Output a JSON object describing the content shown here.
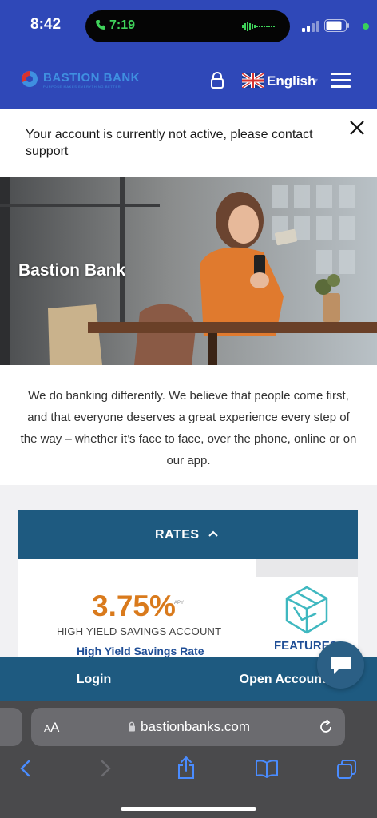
{
  "status_bar": {
    "time": "8:42",
    "call_time": "7:19",
    "colors": {
      "call": "#3fd25a",
      "background": "#2f48b8"
    }
  },
  "header": {
    "logo_text": "BASTION BANK",
    "logo_tagline": "PURPOSE MAKES EVERYTHING BETTER",
    "language": "English",
    "icons": [
      "lock-icon",
      "uk-flag-icon",
      "hamburger-menu-icon"
    ]
  },
  "alert": {
    "message": "Your account is currently not active, please contact support"
  },
  "hero": {
    "title": "Bastion Bank"
  },
  "intro": {
    "text": "We do banking differently. We believe that people come first, and that everyone deserves a great experience every step of the way – whether it’s face to face, over the phone, online or on our app."
  },
  "rates": {
    "header_label": "RATES",
    "rate_value": "3.75%",
    "rate_unit": "APY",
    "account_name": "HIGH YIELD SAVINGS ACCOUNT",
    "link_label": "High Yield Savings Rate",
    "feature_label": "FEATURES"
  },
  "actions": {
    "login": "Login",
    "open_account": "Open Account"
  },
  "browser": {
    "aa_label": "AA",
    "url": "bastionbanks.com"
  },
  "colors": {
    "brand_blue": "#2f48b8",
    "rates_blue": "#1e5a80",
    "rate_orange": "#d97a1c",
    "link_blue": "#1f4e96",
    "feature_teal": "#3fb8c0"
  }
}
